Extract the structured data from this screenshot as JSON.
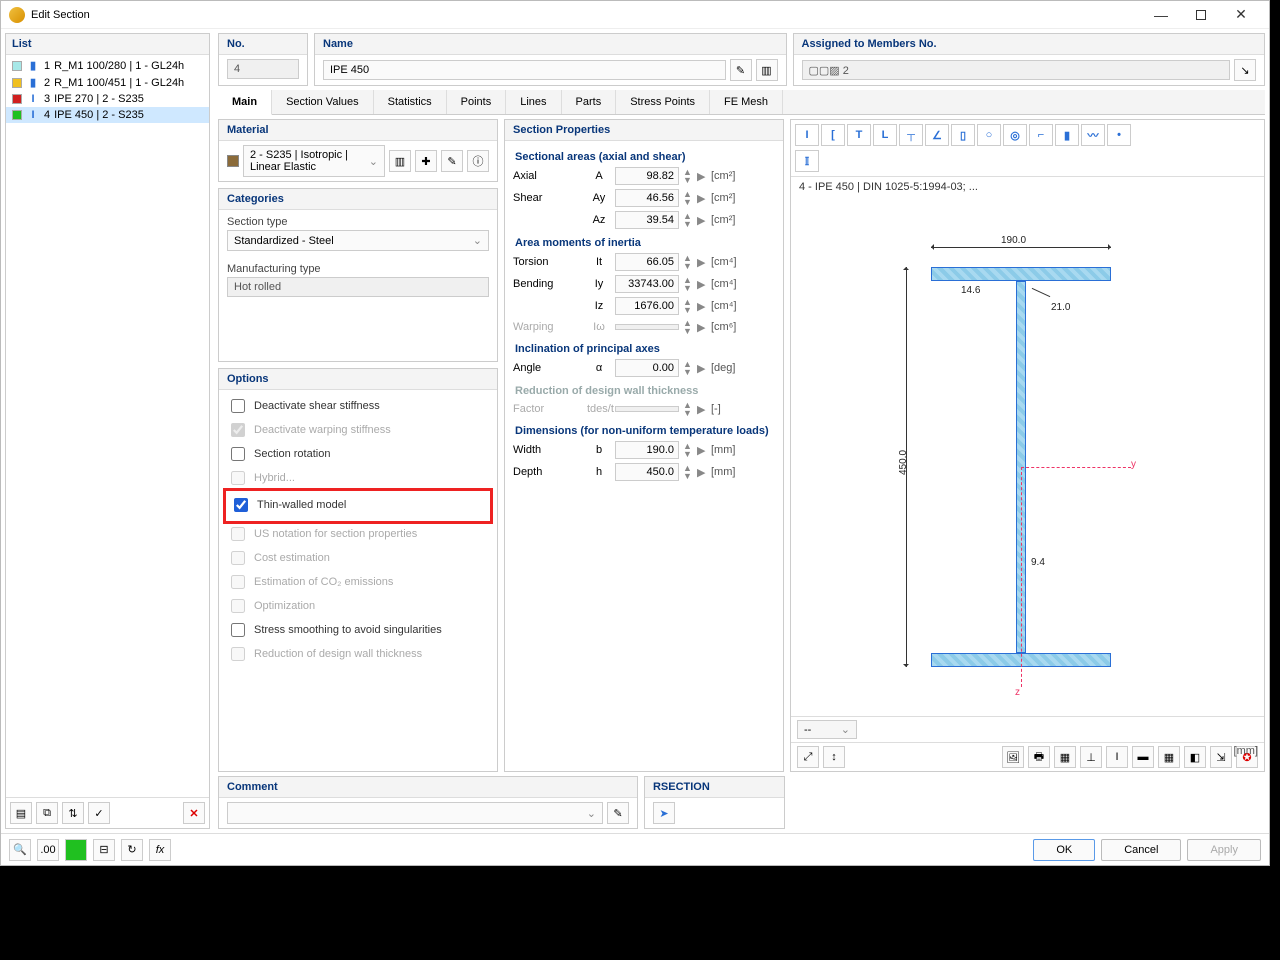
{
  "window": {
    "title": "Edit Section"
  },
  "list": {
    "header": "List",
    "items": [
      {
        "n": "1",
        "name": "R_M1 100/280 | 1 - GL24h",
        "color": "#a7e8e8",
        "shape": "▮"
      },
      {
        "n": "2",
        "name": "R_M1 100/451 | 1 - GL24h",
        "color": "#f0c020",
        "shape": "▮"
      },
      {
        "n": "3",
        "name": "IPE 270 | 2 - S235",
        "color": "#d02020",
        "shape": "I"
      },
      {
        "n": "4",
        "name": "IPE 450 | 2 - S235",
        "color": "#20c020",
        "shape": "I"
      }
    ],
    "selected": 3
  },
  "top": {
    "no_label": "No.",
    "no_value": "4",
    "name_label": "Name",
    "name_value": "IPE 450",
    "assigned_label": "Assigned to Members No.",
    "assigned_value": "▢▢▨ 2"
  },
  "tabs": [
    "Main",
    "Section Values",
    "Statistics",
    "Points",
    "Lines",
    "Parts",
    "Stress Points",
    "FE Mesh"
  ],
  "material": {
    "header": "Material",
    "value": "2 - S235 | Isotropic | Linear Elastic",
    "swatch": "#8b6b3a"
  },
  "categories": {
    "header": "Categories",
    "sectype_lbl": "Section type",
    "sectype_val": "Standardized - Steel",
    "mfg_lbl": "Manufacturing type",
    "mfg_val": "Hot rolled"
  },
  "options": {
    "header": "Options",
    "items": [
      {
        "label": "Deactivate shear stiffness",
        "checked": false,
        "disabled": false
      },
      {
        "label": "Deactivate warping stiffness",
        "checked": true,
        "disabled": true
      },
      {
        "label": "Section rotation",
        "checked": false,
        "disabled": false
      },
      {
        "label": "Hybrid...",
        "checked": false,
        "disabled": true
      },
      {
        "label": "Thin-walled model",
        "checked": true,
        "disabled": false,
        "highlight": true
      },
      {
        "label": "US notation for section properties",
        "checked": false,
        "disabled": true
      },
      {
        "label": "Cost estimation",
        "checked": false,
        "disabled": true
      },
      {
        "label": "Estimation of CO₂ emissions",
        "checked": false,
        "disabled": true
      },
      {
        "label": "Optimization",
        "checked": false,
        "disabled": true
      },
      {
        "label": "Stress smoothing to avoid singularities",
        "checked": false,
        "disabled": false
      },
      {
        "label": "Reduction of design wall thickness",
        "checked": false,
        "disabled": true
      }
    ]
  },
  "props": {
    "header": "Section Properties",
    "groups": [
      {
        "title": "Sectional areas (axial and shear)",
        "rows": [
          {
            "lbl": "Axial",
            "sym": "A",
            "val": "98.82",
            "unit": "[cm²]"
          },
          {
            "lbl": "Shear",
            "sym": "Ay",
            "val": "46.56",
            "unit": "[cm²]"
          },
          {
            "lbl": "",
            "sym": "Az",
            "val": "39.54",
            "unit": "[cm²]"
          }
        ]
      },
      {
        "title": "Area moments of inertia",
        "rows": [
          {
            "lbl": "Torsion",
            "sym": "It",
            "val": "66.05",
            "unit": "[cm⁴]"
          },
          {
            "lbl": "Bending",
            "sym": "Iy",
            "val": "33743.00",
            "unit": "[cm⁴]"
          },
          {
            "lbl": "",
            "sym": "Iz",
            "val": "1676.00",
            "unit": "[cm⁴]"
          },
          {
            "lbl": "Warping",
            "sym": "Iω",
            "val": "",
            "unit": "[cm⁶]",
            "ro": true
          }
        ]
      },
      {
        "title": "Inclination of principal axes",
        "rows": [
          {
            "lbl": "Angle",
            "sym": "α",
            "val": "0.00",
            "unit": "[deg]"
          }
        ]
      },
      {
        "title": "Reduction of design wall thickness",
        "muted": true,
        "rows": [
          {
            "lbl": "Factor",
            "sym": "tdes/t",
            "val": "",
            "unit": "[-]",
            "ro": true
          }
        ]
      },
      {
        "title": "Dimensions (for non-uniform temperature loads)",
        "rows": [
          {
            "lbl": "Width",
            "sym": "b",
            "val": "190.0",
            "unit": "[mm]"
          },
          {
            "lbl": "Depth",
            "sym": "h",
            "val": "450.0",
            "unit": "[mm]"
          }
        ]
      }
    ]
  },
  "viewer": {
    "caption": "4 - IPE 450 | DIN 1025-5:1994-03; ...",
    "dims": {
      "width": "190.0",
      "height": "450.0",
      "tf": "14.6",
      "tw": "9.4",
      "r": "21.0"
    },
    "axis_y": "y",
    "axis_z": "z",
    "unit": "[mm]"
  },
  "comment": {
    "header": "Comment",
    "value": ""
  },
  "rsection": {
    "header": "RSECTION"
  },
  "footer": {
    "ok": "OK",
    "cancel": "Cancel",
    "apply": "Apply"
  }
}
